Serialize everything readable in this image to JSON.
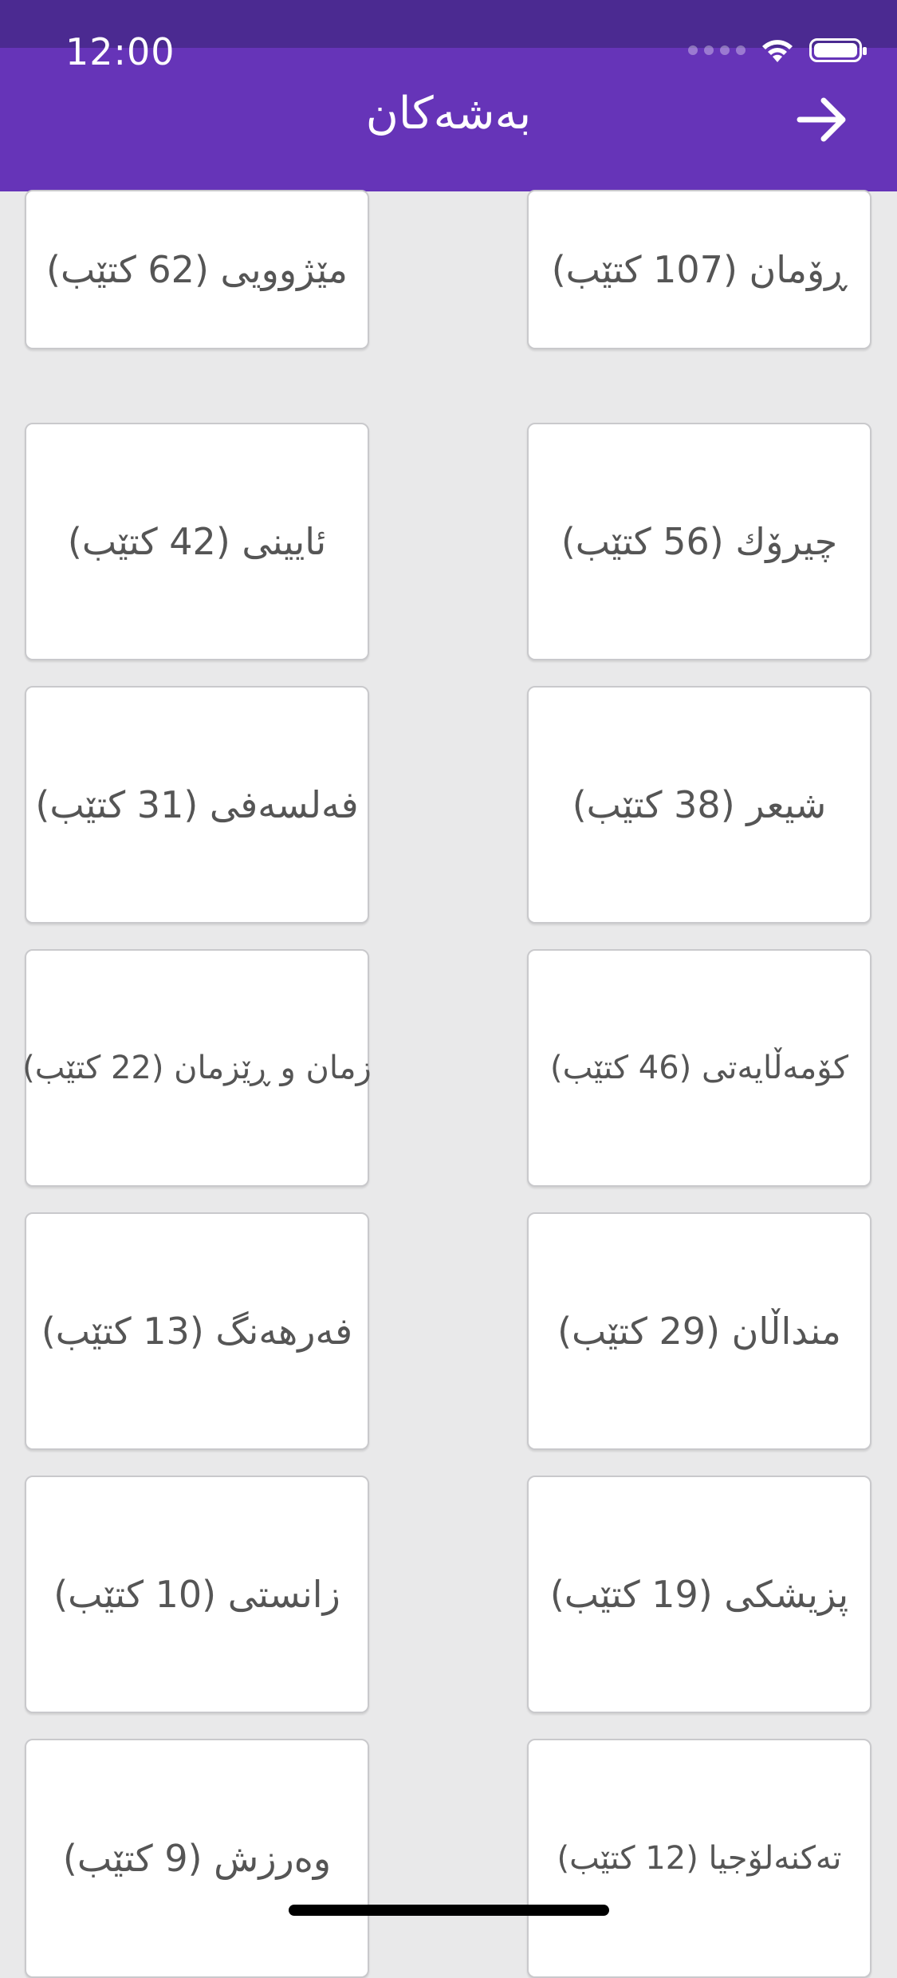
{
  "status_bar": {
    "time": "12:00"
  },
  "header": {
    "title": "بەشەکان",
    "back_icon": "arrow-right-icon"
  },
  "categories": [
    {
      "label": "ڕۆمان (107 کتێب)"
    },
    {
      "label": "مێژوویی (62 کتێب)"
    },
    {
      "label": "چیرۆك (56 کتێب)"
    },
    {
      "label": "ئایینی (42 کتێب)"
    },
    {
      "label": "شیعر (38 کتێب)"
    },
    {
      "label": "فەلسەفی (31 کتێب)"
    },
    {
      "label": "کۆمەڵایەتی (46 کتێب)"
    },
    {
      "label": "زمان و ڕێزمان (22 کتێب)"
    },
    {
      "label": "منداڵان (29 کتێب)"
    },
    {
      "label": "فەرهەنگ (13 کتێب)"
    },
    {
      "label": "پزیشکی (19 کتێب)"
    },
    {
      "label": "زانستی (10 کتێب)"
    },
    {
      "label": "تەکنەلۆجیا (12 کتێب)"
    },
    {
      "label": "وەرزش (9 کتێب)"
    }
  ],
  "colors": {
    "header": "#6634b8",
    "status": "#4b2a91",
    "background": "#e9e9ea"
  }
}
